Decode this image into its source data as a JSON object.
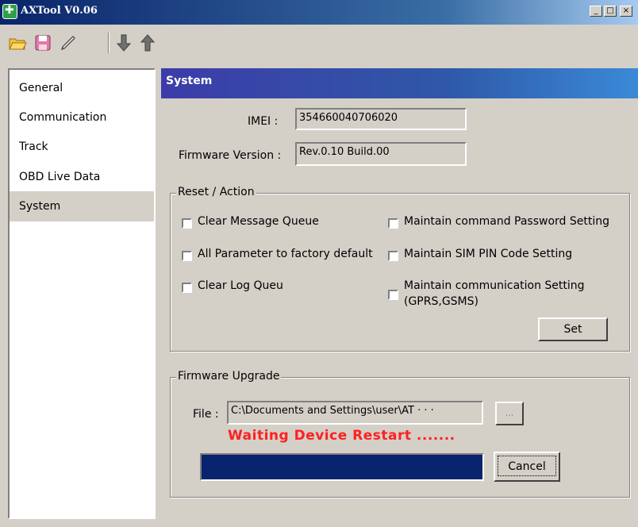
{
  "window": {
    "title": "AXTool V0.06",
    "min": "_",
    "max": "□",
    "close": "×"
  },
  "toolbar": {
    "icons": [
      "open-folder-icon",
      "save-icon",
      "edit-icon",
      "download-arrow-icon",
      "upload-arrow-icon"
    ]
  },
  "nav": {
    "items": [
      {
        "label": "General"
      },
      {
        "label": "Communication"
      },
      {
        "label": "Track"
      },
      {
        "label": "OBD Live Data"
      },
      {
        "label": "System",
        "selected": true
      }
    ]
  },
  "section": {
    "title": "System"
  },
  "imei": {
    "label": "IMEI :",
    "value": "354660040706020"
  },
  "firmware": {
    "label": "Firmware Version :",
    "value": "Rev.0.10 Build.00"
  },
  "reset": {
    "title": "Reset / Action",
    "options": [
      "Clear Message Queue",
      "All Parameter to factory default",
      "Clear Log Queu",
      "Maintain command Password Setting",
      "Maintain SIM PIN Code Setting",
      "Maintain communication Setting",
      "(GPRS,GSMS)"
    ],
    "set_label": "Set"
  },
  "upgrade": {
    "title": "Firmware Upgrade",
    "file_label": "File :",
    "file_value": "C:\\Documents and Settings\\user\\AT · · ·",
    "browse_label": "...",
    "status": "Waiting  Device Restart .......",
    "progress_fraction": 1.0,
    "cancel_label": "Cancel"
  },
  "colors": {
    "status": "#ff2020",
    "progress": "#08246e",
    "header": "#3c3ca8"
  }
}
